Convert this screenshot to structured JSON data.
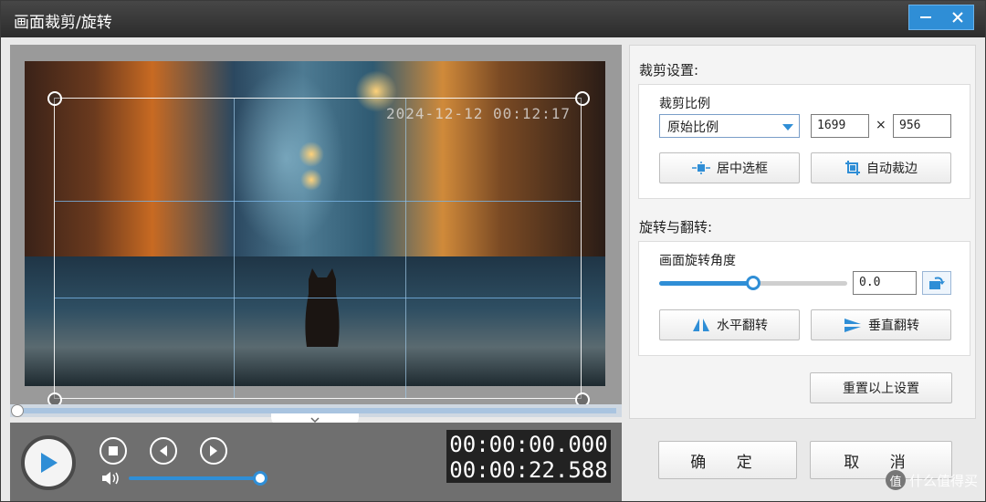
{
  "window": {
    "title": "画面裁剪/旋转",
    "minimize_icon": "minimize-icon",
    "close_icon": "close-icon"
  },
  "preview": {
    "timestamp_overlay": "2024-12-12  00:12:17",
    "current_time": "00:00:00.000",
    "total_time": "00:00:22.588",
    "volume_fraction": 1.0,
    "playback_fraction": 0.0
  },
  "crop": {
    "section_title": "裁剪设置:",
    "ratio_label": "裁剪比例",
    "ratio_value": "原始比例",
    "width": "1699",
    "times": "×",
    "height": "956",
    "center_button": "居中选框",
    "auto_button": "自动裁边"
  },
  "rotate": {
    "section_title": "旋转与翻转:",
    "angle_label": "画面旋转角度",
    "angle_value": "0.0",
    "angle_fraction": 0.5,
    "hflip_button": "水平翻转",
    "vflip_button": "垂直翻转"
  },
  "reset_button": "重置以上设置",
  "ok_button": "确 定",
  "cancel_button": "取 消",
  "watermark": {
    "logo_text": "值",
    "text": "什么值得买"
  },
  "colors": {
    "accent": "#2f8ed6",
    "titlebar": "#333333"
  }
}
